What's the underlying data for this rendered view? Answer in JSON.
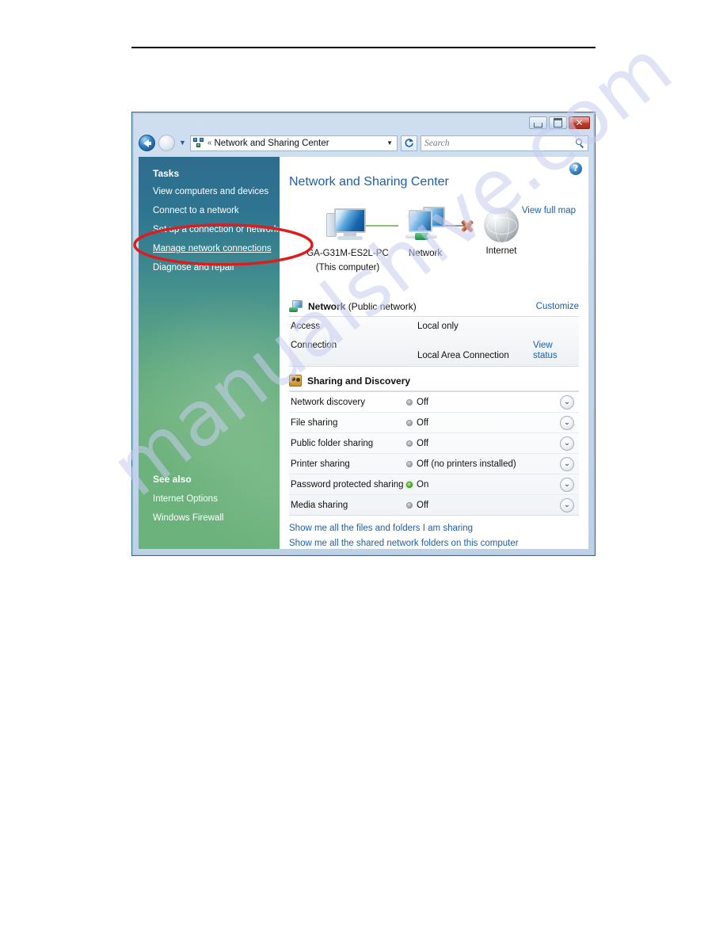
{
  "window": {
    "title": "Network and Sharing Center",
    "controls": {
      "minimize": "Minimize",
      "maximize": "Maximize",
      "close": "Close",
      "close_glyph": "✕"
    },
    "address": {
      "icon": "network-icon",
      "chevrons": "«",
      "path": "Network and Sharing Center",
      "dropdown_caret": "▼"
    },
    "refresh_label": "↻",
    "search": {
      "placeholder": "Search",
      "value": ""
    },
    "help_label": "?"
  },
  "sidebar": {
    "tasks_heading": "Tasks",
    "tasks": [
      {
        "label": "View computers and devices",
        "current": false
      },
      {
        "label": "Connect to a network",
        "current": false
      },
      {
        "label": "Set up a connection or network",
        "current": false
      },
      {
        "label": "Manage network connections",
        "current": true
      },
      {
        "label": "Diagnose and repair",
        "current": false
      }
    ],
    "see_also_heading": "See also",
    "see_also": [
      {
        "label": "Internet Options"
      },
      {
        "label": "Windows Firewall"
      }
    ]
  },
  "content": {
    "page_title": "Network and Sharing Center",
    "view_full_map": "View full map",
    "map": {
      "computer_name": "GA-G31M-ES2L-PC",
      "computer_sub": "(This computer)",
      "network_label": "Network",
      "internet_label": "Internet"
    },
    "network_section": {
      "name": "Network",
      "type": "(Public network)",
      "customize_link": "Customize",
      "rows": [
        {
          "key": "Access",
          "value": "Local only",
          "action": ""
        },
        {
          "key": "Connection",
          "value": "Local Area Connection",
          "action": "View status"
        }
      ]
    },
    "sharing_section": {
      "heading": "Sharing and Discovery",
      "items": [
        {
          "name": "Network discovery",
          "state": "Off",
          "status": "Off",
          "on": false
        },
        {
          "name": "File sharing",
          "state": "Off",
          "status": "Off",
          "on": false
        },
        {
          "name": "Public folder sharing",
          "state": "Off",
          "status": "Off",
          "on": false
        },
        {
          "name": "Printer sharing",
          "state": "Off",
          "status": "Off (no printers installed)",
          "on": false
        },
        {
          "name": "Password protected sharing",
          "state": "On",
          "status": "On",
          "on": true
        },
        {
          "name": "Media sharing",
          "state": "Off",
          "status": "Off",
          "on": false
        }
      ],
      "expand_glyph": "⌄"
    },
    "bottom_links": [
      "Show me all the files and folders I am sharing",
      "Show me all the shared network folders on this computer"
    ]
  },
  "annotation": {
    "shape": "ellipse",
    "color": "#e01b1b",
    "targets": "Manage network connections"
  },
  "watermark": {
    "text": "manualshive.com",
    "color": "#c7cdf0"
  },
  "colors": {
    "accent_link": "#1a5fb0",
    "title_blue": "#1e5ea8",
    "sidebar_top": "#2f6c8e",
    "sidebar_bottom": "#6cb27c",
    "status_on": "#4fae2e",
    "status_off": "#9aa2a9",
    "annotation_red": "#e01b1b"
  }
}
